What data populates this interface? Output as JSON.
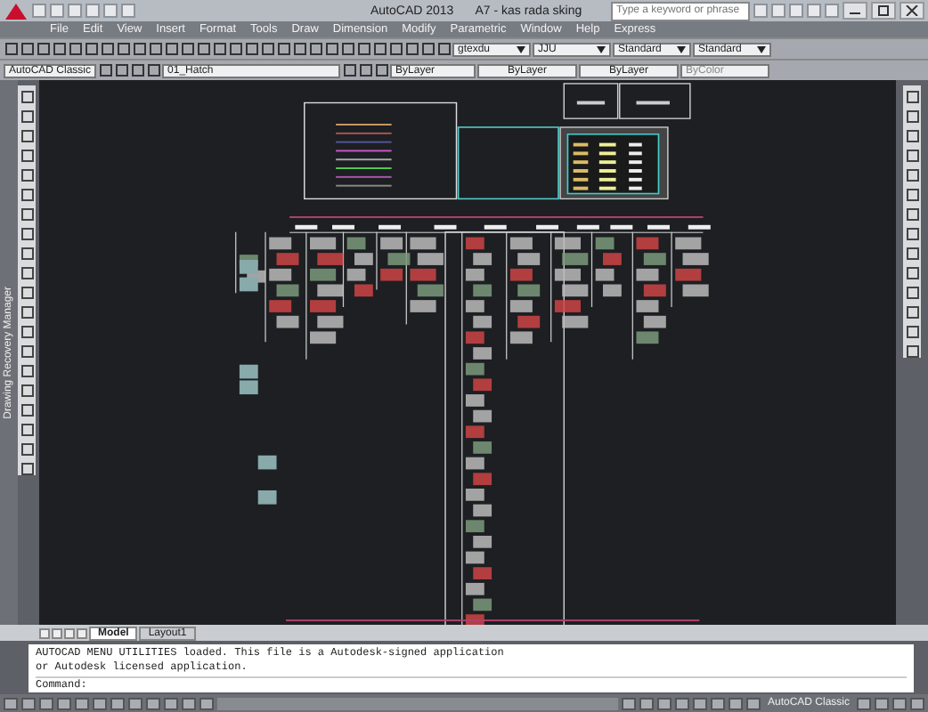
{
  "window": {
    "title": "AutoCAD 2013",
    "document": "A7 - kas rada sking",
    "search": {
      "placeholder": "Type a keyword or phrase"
    }
  },
  "menu": [
    "File",
    "Edit",
    "View",
    "Insert",
    "Format",
    "Tools",
    "Draw",
    "Dimension",
    "Modify",
    "Parametric",
    "Window",
    "Help",
    "Express"
  ],
  "styles_toolbar": {
    "dropdowns": [
      "gtexdu",
      "JJU",
      "Standard",
      "Standard"
    ]
  },
  "layers_toolbar": {
    "workspace": "AutoCAD Classic",
    "layer": "01_Hatch",
    "color_control": "ByLayer",
    "linetype": "ByLayer",
    "lineweight": "ByLayer",
    "plotstyle": "ByColor"
  },
  "dock": {
    "label": "Drawing Recovery Manager"
  },
  "layout_tabs": [
    {
      "label": "Model",
      "selected": true
    },
    {
      "label": "Layout1",
      "selected": false
    }
  ],
  "command": {
    "lines": [
      "AUTOCAD MENU UTILITIES loaded. This file is a Autodesk-signed application",
      "or Autodesk licensed application."
    ],
    "prompt": "Command:"
  },
  "status_bar": {
    "workspace": "AutoCAD Classic"
  }
}
